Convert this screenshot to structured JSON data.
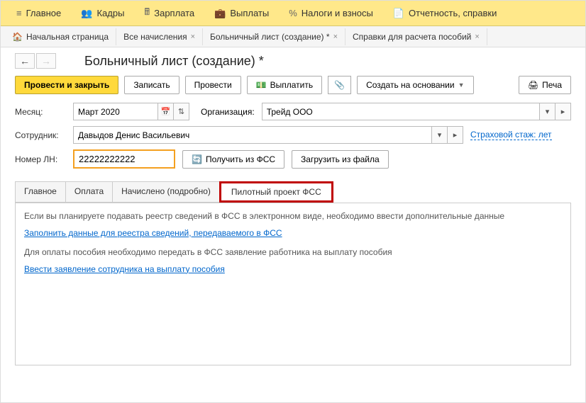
{
  "topnav": {
    "main": "Главное",
    "staff": "Кадры",
    "salary": "Зарплата",
    "payments": "Выплаты",
    "taxes": "Налоги и взносы",
    "reports": "Отчетность, справки"
  },
  "sectionTabs": {
    "home": "Начальная страница",
    "all": "Все начисления",
    "current": "Больничный лист (создание) *",
    "benefit": "Справки для расчета пособий"
  },
  "pageTitle": "Больничный лист (создание) *",
  "actions": {
    "saveClose": "Провести и закрыть",
    "save": "Записать",
    "post": "Провести",
    "pay": "Выплатить",
    "createBy": "Создать на основании",
    "print": "Печа"
  },
  "form": {
    "monthLabel": "Месяц:",
    "monthValue": "Март 2020",
    "orgLabel": "Организация:",
    "orgValue": "Трейд ООО",
    "empLabel": "Сотрудник:",
    "empValue": "Давыдов Денис Васильевич",
    "insurLink": "Страховой стаж: лет",
    "lnLabel": "Номер ЛН:",
    "lnValue": "22222222222",
    "getFss": "Получить из ФСС",
    "loadFile": "Загрузить из файла"
  },
  "tabs": {
    "main": "Главное",
    "payment": "Оплата",
    "accrued": "Начислено (подробно)",
    "pilot": "Пилотный проект ФСС"
  },
  "content": {
    "text1": "Если вы планируете подавать реестр сведений в ФСС в электронном виде, необходимо ввести дополнительные данные",
    "link1": "Заполнить данные для реестра сведений, передаваемого в ФСС",
    "text2": "Для оплаты пособия необходимо передать в ФСС заявление работника на выплату пособия",
    "link2": "Ввести заявление сотрудника на выплату пособия"
  }
}
